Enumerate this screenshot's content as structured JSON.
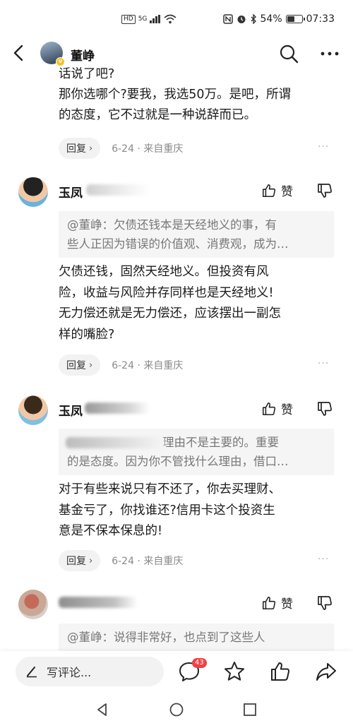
{
  "status_bar": {
    "network": "HD",
    "signal": "5G",
    "battery": "54%",
    "battery_level": 0.54,
    "time": "07:33"
  },
  "header": {
    "name": "董峥"
  },
  "comments": [
    {
      "text_lines": [
        "话说了吧?",
        "那你选哪个?要我，我选50万。是吧，所谓",
        "的态度，它不过就是一种说辞而已。"
      ],
      "reply_label": "回复",
      "meta": "6-24 · 来自重庆"
    },
    {
      "username": "玉凤",
      "like_label": "赞",
      "quote_lines": [
        "@董峥：欠债还钱本是天经地义的事，有",
        "些人正因为错误的价值观、消费观，成为…"
      ],
      "text_lines": [
        "欠债还钱，固然天经地义。但投资有风",
        "险，收益与风险并存同样也是天经地义!",
        "无力偿还就是无力偿还，应该摆出一副怎",
        "样的嘴脸?"
      ],
      "reply_label": "回复",
      "meta": "6-24 · 来自重庆"
    },
    {
      "username": "玉凤",
      "like_label": "赞",
      "quote_lines": [
        "理由不是主要的。重要",
        "的是态度。因为你不管找什么理由，借口…"
      ],
      "text_lines": [
        "对于有些来说只有不还了，你去买理财、",
        "基金亏了，你找谁还?信用卡这个投资生",
        "意是不保本保息的!"
      ],
      "reply_label": "回复",
      "meta": "6-24 · 来自重庆"
    },
    {
      "username": "",
      "like_label": "赞",
      "quote_lines": [
        "@董峥：说得非常好，也点到了这些人"
      ]
    }
  ],
  "bottom_bar": {
    "write_comment": "写评论...",
    "comment_count": "43"
  },
  "icons": {
    "back": "back-arrow-icon",
    "search": "search-icon",
    "more": "more-dots-icon",
    "like": "thumb-up-icon",
    "dislike": "thumb-down-icon",
    "comment": "comment-bubble-icon",
    "favorite": "star-icon",
    "share": "share-arrow-icon"
  },
  "colors": {
    "badge": "#f04142",
    "quote_bg": "#f5f5f5",
    "meta_text": "#8a8a8a"
  }
}
